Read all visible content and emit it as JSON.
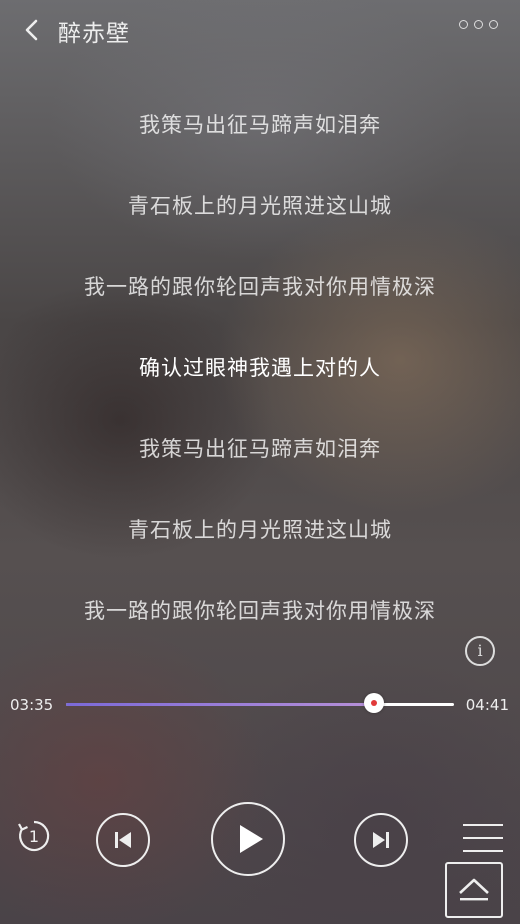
{
  "header": {
    "title": "醉赤壁",
    "back_icon": "chevron-left-icon",
    "more_icon": "more-horizontal-icon"
  },
  "lyrics": [
    "我策马出征马蹄声如泪奔",
    "青石板上的月光照进这山城",
    "我一路的跟你轮回声我对你用情极深",
    "确认过眼神我遇上对的人",
    "我策马出征马蹄声如泪奔",
    "青石板上的月光照进这山城",
    "我一路的跟你轮回声我对你用情极深"
  ],
  "active_lyric_index": 3,
  "player": {
    "current_time": "03:35",
    "total_time": "04:41",
    "progress": 0.794,
    "info_symbol": "i",
    "loop_count": "1"
  },
  "colors": {
    "progress_start": "#7b6ad8",
    "progress_end": "#b690d8",
    "thumb_dot": "#e13a3a"
  }
}
